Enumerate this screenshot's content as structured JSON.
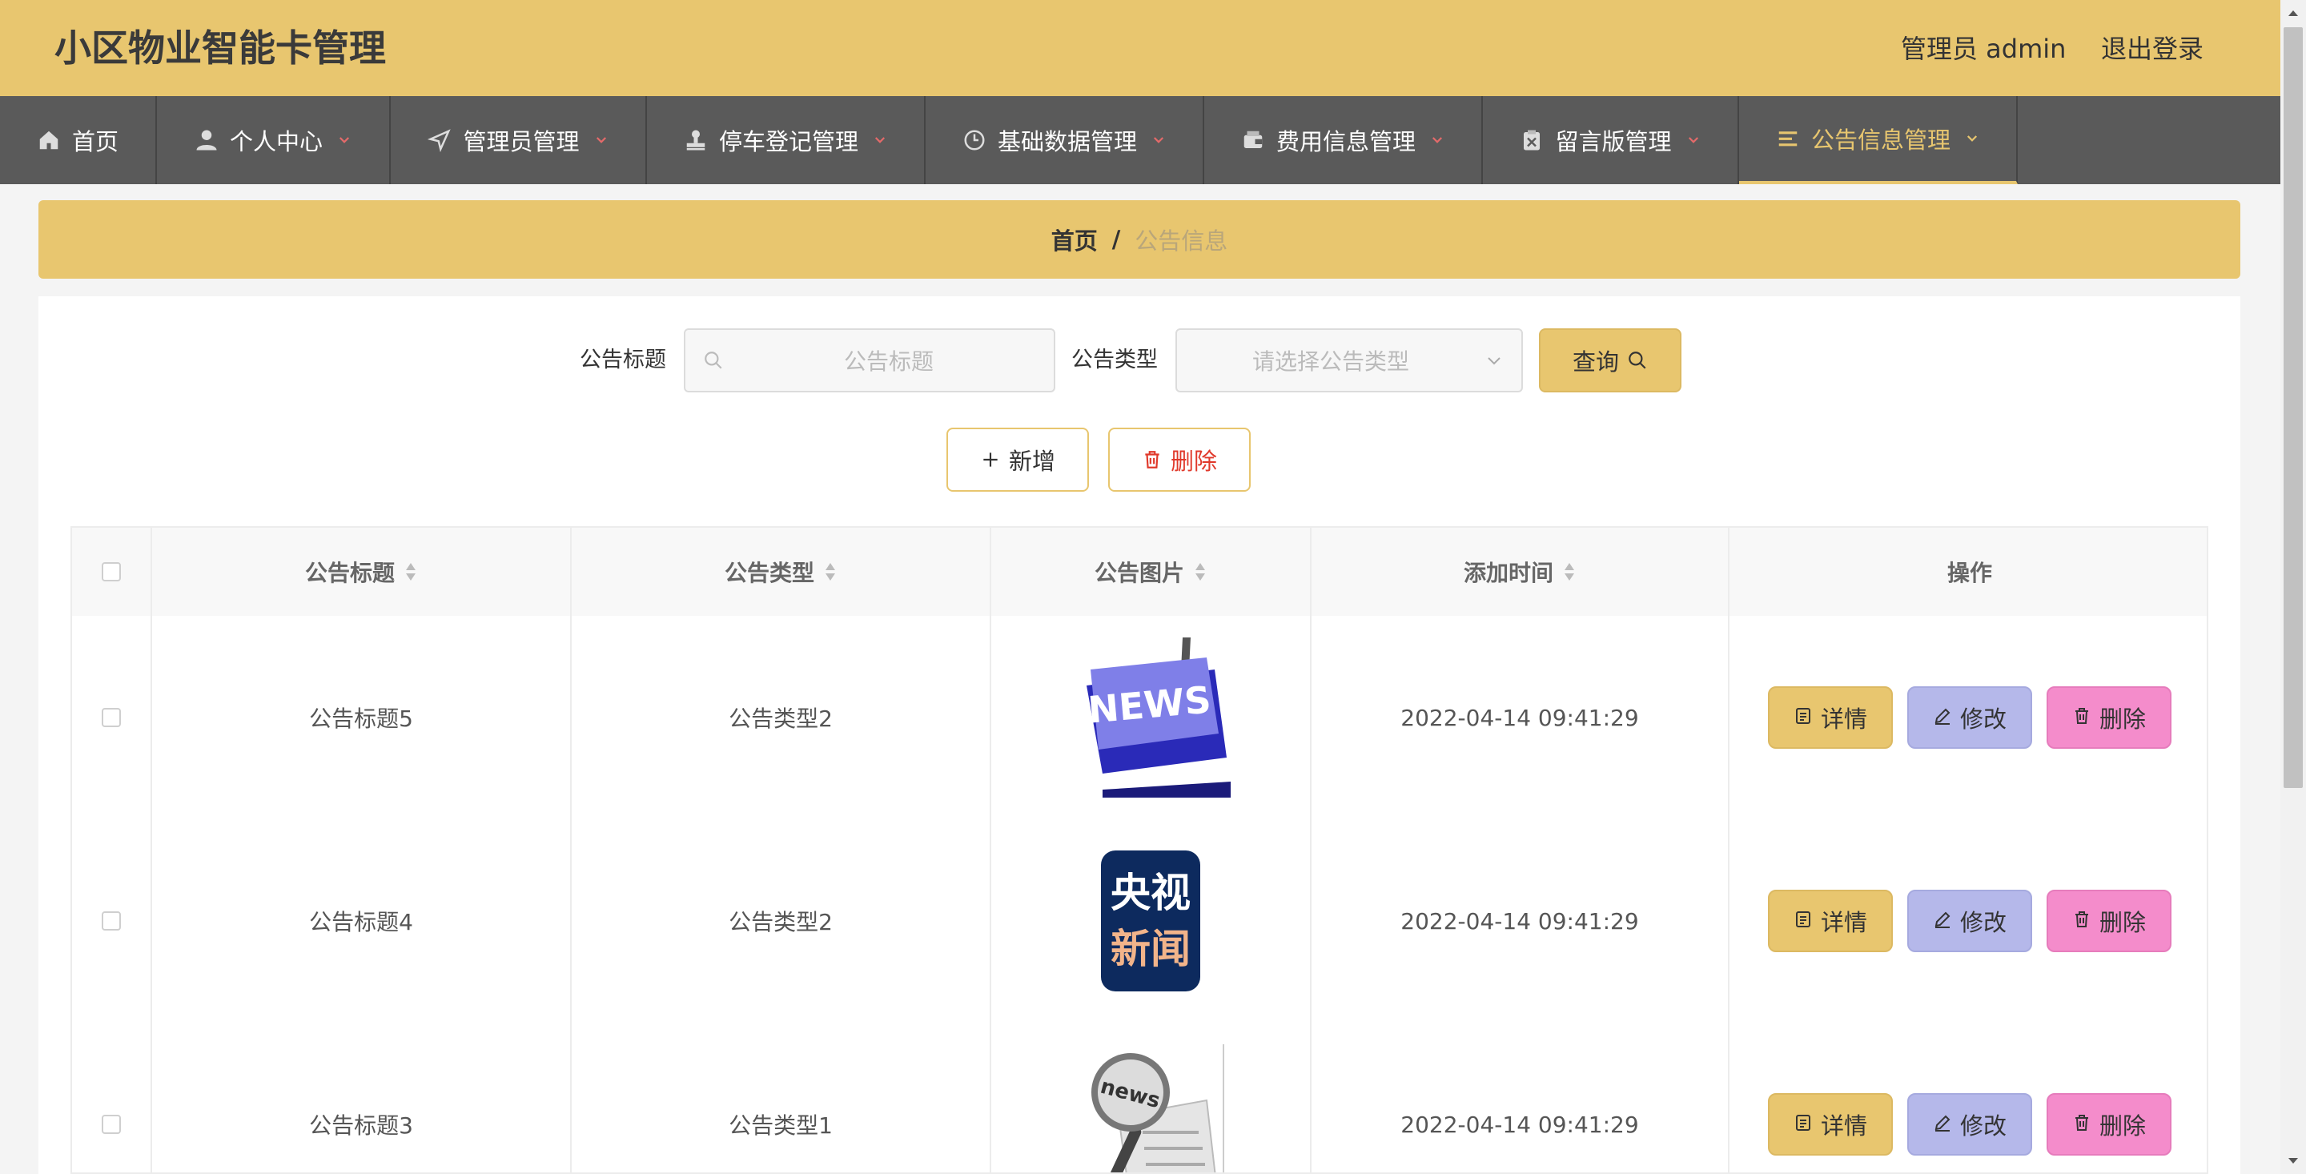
{
  "header": {
    "title": "小区物业智能卡管理",
    "admin_label": "管理员 admin",
    "logout": "退出登录"
  },
  "nav": {
    "items": [
      {
        "label": "首页",
        "icon": "home-icon"
      },
      {
        "label": "个人中心",
        "icon": "user-icon"
      },
      {
        "label": "管理员管理",
        "icon": "send-icon"
      },
      {
        "label": "停车登记管理",
        "icon": "stamp-icon"
      },
      {
        "label": "基础数据管理",
        "icon": "clock-icon"
      },
      {
        "label": "费用信息管理",
        "icon": "wallet-icon"
      },
      {
        "label": "留言版管理",
        "icon": "clipboard-icon"
      },
      {
        "label": "公告信息管理",
        "icon": "list-icon"
      }
    ],
    "active_index": 7
  },
  "breadcrumb": {
    "home": "首页",
    "separator": "/",
    "current": "公告信息"
  },
  "search": {
    "title_label": "公告标题",
    "title_placeholder": "公告标题",
    "type_label": "公告类型",
    "type_placeholder": "请选择公告类型",
    "query_button": "查询"
  },
  "actions": {
    "add": "新增",
    "delete": "删除"
  },
  "table": {
    "columns": [
      "公告标题",
      "公告类型",
      "公告图片",
      "添加时间",
      "操作"
    ],
    "rows": [
      {
        "title": "公告标题5",
        "type": "公告类型2",
        "image": "news-keyboard",
        "time": "2022-04-14 09:41:29"
      },
      {
        "title": "公告标题4",
        "type": "公告类型2",
        "image": "cctv-news-logo",
        "image_text": [
          "央视",
          "新闻"
        ],
        "time": "2022-04-14 09:41:29"
      },
      {
        "title": "公告标题3",
        "type": "公告类型1",
        "image": "news-magnifier",
        "image_text": [
          "news"
        ],
        "time": "2022-04-14 09:41:29"
      }
    ],
    "row_actions": {
      "detail": "详情",
      "edit": "修改",
      "delete": "删除"
    }
  },
  "colors": {
    "primary": "#e8c66f",
    "nav_bg": "#5a5a5a",
    "edit": "#b5b8ea",
    "danger": "#f48ccb",
    "delete_text": "#e0392b"
  }
}
